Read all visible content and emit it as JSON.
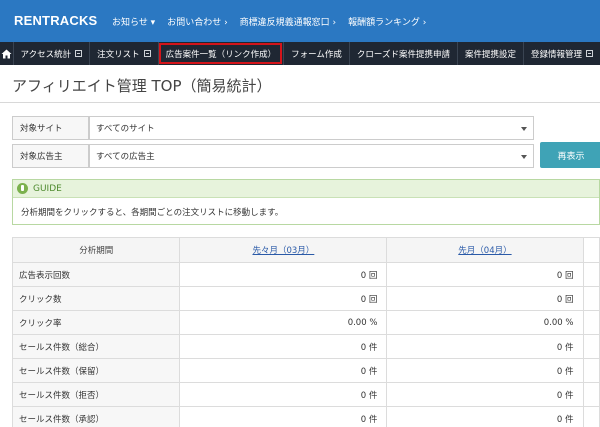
{
  "header": {
    "logo": "RENTRACKS",
    "links": [
      "お知らせ ▾",
      "お問い合わせ ›",
      "商標違反規義通報窓口 ›",
      "報酬額ランキング ›"
    ]
  },
  "nav": {
    "items": [
      {
        "label": "アクセス統計",
        "box": true
      },
      {
        "label": "注文リスト",
        "box": true
      },
      {
        "label": "広告案件一覧（リンク作成）",
        "box": false,
        "highlighted": true
      },
      {
        "label": "フォーム作成",
        "box": false
      },
      {
        "label": "クローズド案件提携申請",
        "box": false
      },
      {
        "label": "案件提携設定",
        "box": false
      },
      {
        "label": "登録情報管理",
        "box": true
      }
    ]
  },
  "page": {
    "title": "アフィリエイト管理 TOP（簡易統計）"
  },
  "filters": {
    "site_label": "対象サイト",
    "site_value": "すべてのサイト",
    "advertiser_label": "対象広告主",
    "advertiser_value": "すべての広告主",
    "redisplay_button": "再表示"
  },
  "guide": {
    "title": "GUIDE",
    "text": "分析期間をクリックすると、各期間ごとの注文リストに移動します。"
  },
  "table": {
    "header_label": "分析期間",
    "periods": [
      "先々月（03月）",
      "先月（04月）"
    ],
    "rows": [
      {
        "label": "広告表示回数",
        "values": [
          "0 回",
          "0 回"
        ]
      },
      {
        "label": "クリック数",
        "values": [
          "0 回",
          "0 回"
        ]
      },
      {
        "label": "クリック率",
        "values": [
          "0.00 %",
          "0.00 %"
        ]
      },
      {
        "label": "セールス件数（総合）",
        "values": [
          "0 件",
          "0 件"
        ]
      },
      {
        "label": "セールス件数（保留）",
        "values": [
          "0 件",
          "0 件"
        ]
      },
      {
        "label": "セールス件数（拒否）",
        "values": [
          "0 件",
          "0 件"
        ]
      },
      {
        "label": "セールス件数（承認）",
        "values": [
          "0 件",
          "0 件"
        ]
      }
    ]
  },
  "colors": {
    "header_bg": "#2b78c2",
    "nav_bg": "#1f2733",
    "highlight": "#d4141a",
    "button": "#3fa3b6",
    "guide_green": "#7bb14d"
  }
}
